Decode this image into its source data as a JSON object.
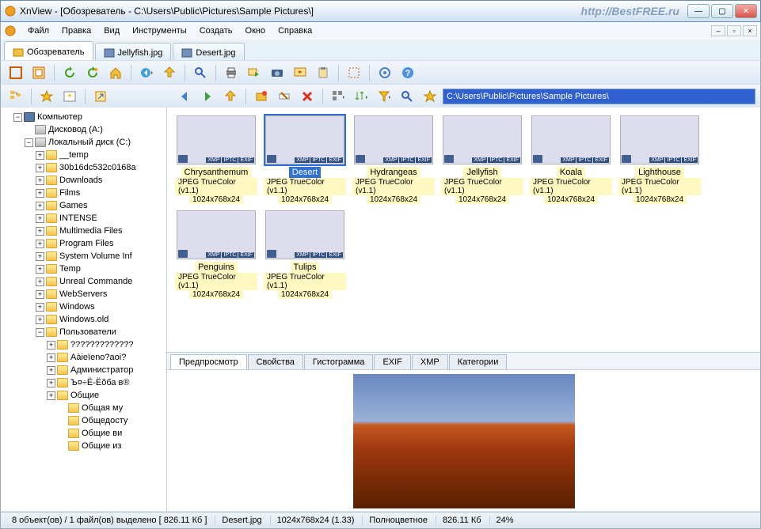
{
  "title": "XnView - [Обозреватель - C:\\Users\\Public\\Pictures\\Sample Pictures\\]",
  "watermark": "http://BestFREE.ru",
  "menu": [
    "Файл",
    "Правка",
    "Вид",
    "Инструменты",
    "Создать",
    "Окно",
    "Справка"
  ],
  "tabs": [
    {
      "label": "Обозреватель",
      "icon": "browser",
      "active": true
    },
    {
      "label": "Jellyfish.jpg",
      "icon": "img",
      "active": false
    },
    {
      "label": "Desert.jpg",
      "icon": "img",
      "active": false
    }
  ],
  "addressbar": "C:\\Users\\Public\\Pictures\\Sample Pictures\\",
  "tree": {
    "root": "Компьютер",
    "driveA": "Дисковод (A:)",
    "driveC": "Локальный диск (C:)",
    "folders": [
      "__temp",
      "30b16dc532c0168a",
      "Downloads",
      "Films",
      "Games",
      "INTENSE",
      "Multimedia Files",
      "Program Files",
      "System Volume Inf",
      "Temp",
      "Unreal Commande",
      "WebServers",
      "Windows",
      "Windows.old"
    ],
    "users": "Пользователи",
    "userSub": [
      "?????????????",
      "Aàieïeno?aoi?",
      "Администратор",
      "Ъ¤÷Ё-Ёõба в®",
      "Общие"
    ],
    "obshSub": [
      "Общая му",
      "Общедосту",
      "Общие ви",
      "Общие из"
    ]
  },
  "thumbs": [
    {
      "name": "Chrysanthemum",
      "type": "JPEG TrueColor (v1.1)",
      "dim": "1024x768x24",
      "sw": "sw-chrys",
      "sel": false
    },
    {
      "name": "Desert",
      "type": "JPEG TrueColor (v1.1)",
      "dim": "1024x768x24",
      "sw": "sw-desert",
      "sel": true
    },
    {
      "name": "Hydrangeas",
      "type": "JPEG TrueColor (v1.1)",
      "dim": "1024x768x24",
      "sw": "sw-hydra",
      "sel": false
    },
    {
      "name": "Jellyfish",
      "type": "JPEG TrueColor (v1.1)",
      "dim": "1024x768x24",
      "sw": "sw-jelly",
      "sel": false
    },
    {
      "name": "Koala",
      "type": "JPEG TrueColor (v1.1)",
      "dim": "1024x768x24",
      "sw": "sw-koala",
      "sel": false
    },
    {
      "name": "Lighthouse",
      "type": "JPEG TrueColor (v1.1)",
      "dim": "1024x768x24",
      "sw": "sw-light",
      "sel": false
    },
    {
      "name": "Penguins",
      "type": "JPEG TrueColor (v1.1)",
      "dim": "1024x768x24",
      "sw": "sw-peng",
      "sel": false
    },
    {
      "name": "Tulips",
      "type": "JPEG TrueColor (v1.1)",
      "dim": "1024x768x24",
      "sw": "sw-tulip",
      "sel": false
    }
  ],
  "badges": [
    "XMP",
    "IPTC",
    "EXIF"
  ],
  "bottomTabs": [
    "Предпросмотр",
    "Свойства",
    "Гистограмма",
    "EXIF",
    "XMP",
    "Категории"
  ],
  "status": {
    "sel": "8 объект(ов) / 1 файл(ов) выделено   [ 826.11 Кб ]",
    "file": "Desert.jpg",
    "dim": "1024x768x24 (1.33)",
    "color": "Полноцветное",
    "size": "826.11 Кб",
    "zoom": "24%"
  },
  "toolbar1Icons": [
    "fullscreen",
    "fit",
    "refresh",
    "refresh-all",
    "home",
    "back-dd",
    "up",
    "search",
    "print",
    "convert",
    "camera",
    "slideshow",
    "clipboard",
    "capture",
    "settings",
    "help"
  ],
  "toolbar2LeftIcons": [
    "tree",
    "fav",
    "fav-list",
    "shortcut"
  ],
  "toolbar2RightIcons": [
    "back",
    "forward",
    "up",
    "new",
    "rename",
    "delete",
    "view-dd",
    "sort-dd",
    "filter-dd",
    "find",
    "star"
  ]
}
